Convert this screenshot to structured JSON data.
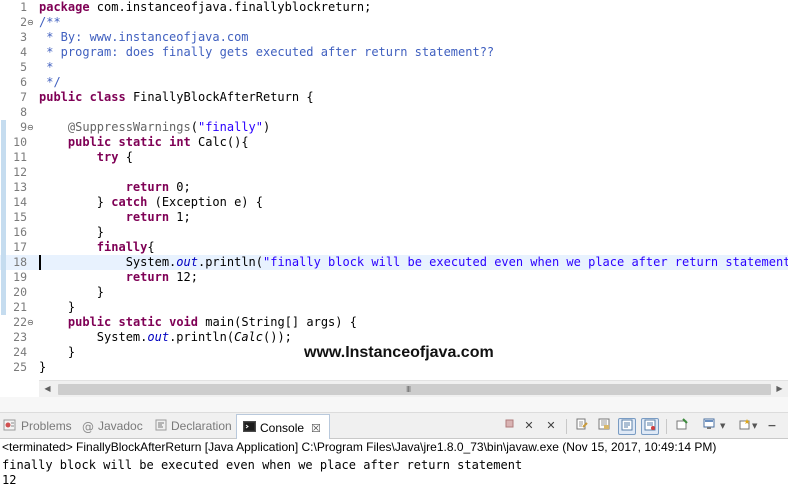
{
  "editor": {
    "lines": [
      {
        "num": "1",
        "fold": "",
        "code": [
          {
            "t": "package",
            "c": "kw"
          },
          {
            "t": " com.instanceofjava.finallyblockreturn;"
          }
        ]
      },
      {
        "num": "2",
        "fold": "⊖",
        "code": [
          {
            "t": "/**",
            "c": "cm"
          }
        ]
      },
      {
        "num": "3",
        "fold": "",
        "code": [
          {
            "t": " * By: www.instanceofjava.com",
            "c": "cm"
          }
        ]
      },
      {
        "num": "4",
        "fold": "",
        "code": [
          {
            "t": " * program: does finally gets executed after return statement??",
            "c": "cm"
          }
        ]
      },
      {
        "num": "5",
        "fold": "",
        "code": [
          {
            "t": " *",
            "c": "cm"
          }
        ]
      },
      {
        "num": "6",
        "fold": "",
        "code": [
          {
            "t": " */",
            "c": "cm"
          }
        ]
      },
      {
        "num": "7",
        "fold": "",
        "code": [
          {
            "t": "public",
            "c": "kw"
          },
          {
            "t": " "
          },
          {
            "t": "class",
            "c": "kw"
          },
          {
            "t": " FinallyBlockAfterReturn {"
          }
        ]
      },
      {
        "num": "8",
        "fold": "",
        "code": []
      },
      {
        "num": "9",
        "fold": "⊖",
        "code": [
          {
            "t": "    "
          },
          {
            "t": "@SuppressWarnings",
            "c": "an"
          },
          {
            "t": "("
          },
          {
            "t": "\"finally\"",
            "c": "st"
          },
          {
            "t": ")"
          }
        ]
      },
      {
        "num": "10",
        "fold": "",
        "code": [
          {
            "t": "    "
          },
          {
            "t": "public",
            "c": "kw"
          },
          {
            "t": " "
          },
          {
            "t": "static",
            "c": "kw"
          },
          {
            "t": " "
          },
          {
            "t": "int",
            "c": "kw"
          },
          {
            "t": " Calc(){"
          }
        ]
      },
      {
        "num": "11",
        "fold": "",
        "code": [
          {
            "t": "        "
          },
          {
            "t": "try",
            "c": "kw"
          },
          {
            "t": " {"
          }
        ]
      },
      {
        "num": "12",
        "fold": "",
        "code": []
      },
      {
        "num": "13",
        "fold": "",
        "code": [
          {
            "t": "            "
          },
          {
            "t": "return",
            "c": "kw"
          },
          {
            "t": " 0;"
          }
        ]
      },
      {
        "num": "14",
        "fold": "",
        "code": [
          {
            "t": "        } "
          },
          {
            "t": "catch",
            "c": "kw"
          },
          {
            "t": " (Exception e) {"
          }
        ]
      },
      {
        "num": "15",
        "fold": "",
        "code": [
          {
            "t": "            "
          },
          {
            "t": "return",
            "c": "kw"
          },
          {
            "t": " 1;"
          }
        ]
      },
      {
        "num": "16",
        "fold": "",
        "code": [
          {
            "t": "        }"
          }
        ]
      },
      {
        "num": "17",
        "fold": "",
        "code": [
          {
            "t": "        "
          },
          {
            "t": "finally",
            "c": "kw"
          },
          {
            "t": "{"
          }
        ]
      },
      {
        "num": "18",
        "fold": "",
        "code": [
          {
            "t": "            System."
          },
          {
            "t": "out",
            "c": "fi"
          },
          {
            "t": ".println("
          },
          {
            "t": "\"finally block will be executed even when we place after return statement\"",
            "c": "st"
          },
          {
            "t": ");"
          }
        ]
      },
      {
        "num": "19",
        "fold": "",
        "code": [
          {
            "t": "            "
          },
          {
            "t": "return",
            "c": "kw"
          },
          {
            "t": " 12;"
          }
        ]
      },
      {
        "num": "20",
        "fold": "",
        "code": [
          {
            "t": "        }"
          }
        ]
      },
      {
        "num": "21",
        "fold": "",
        "code": [
          {
            "t": "    }"
          }
        ]
      },
      {
        "num": "22",
        "fold": "⊖",
        "code": [
          {
            "t": "    "
          },
          {
            "t": "public",
            "c": "kw"
          },
          {
            "t": " "
          },
          {
            "t": "static",
            "c": "kw"
          },
          {
            "t": " "
          },
          {
            "t": "void",
            "c": "kw"
          },
          {
            "t": " main(String[] args) {"
          }
        ]
      },
      {
        "num": "23",
        "fold": "",
        "code": [
          {
            "t": "        System."
          },
          {
            "t": "out",
            "c": "fi"
          },
          {
            "t": ".println("
          },
          {
            "t": "Calc",
            "c": "it"
          },
          {
            "t": "());"
          }
        ]
      },
      {
        "num": "24",
        "fold": "",
        "code": [
          {
            "t": "    }"
          }
        ]
      },
      {
        "num": "25",
        "fold": "",
        "code": [
          {
            "t": "}"
          }
        ]
      }
    ],
    "current_line": "18",
    "watermark": "www.Instanceofjava.com",
    "scrollbar_grip": "III"
  },
  "views": {
    "tabs": [
      {
        "id": "problems",
        "label": "Problems",
        "icon": "problems-icon"
      },
      {
        "id": "javadoc",
        "label": "Javadoc",
        "icon": "at-icon"
      },
      {
        "id": "declaration",
        "label": "Declaration",
        "icon": "declaration-icon"
      },
      {
        "id": "console",
        "label": "Console",
        "icon": "console-icon",
        "active": true
      }
    ],
    "close_symbol": "☒"
  },
  "console": {
    "header": "<terminated> FinallyBlockAfterReturn [Java Application] C:\\Program Files\\Java\\jre1.8.0_73\\bin\\javaw.exe (Nov 15, 2017, 10:49:14 PM)",
    "output": [
      "finally block will be executed even when we place after return statement",
      "12"
    ]
  },
  "colors": {
    "keyword": "#7f0055",
    "comment": "#3f5fbf",
    "string": "#2a00ff",
    "annotation": "#646464",
    "field": "#0000c0",
    "current_line_bg": "#e8f2fe"
  }
}
